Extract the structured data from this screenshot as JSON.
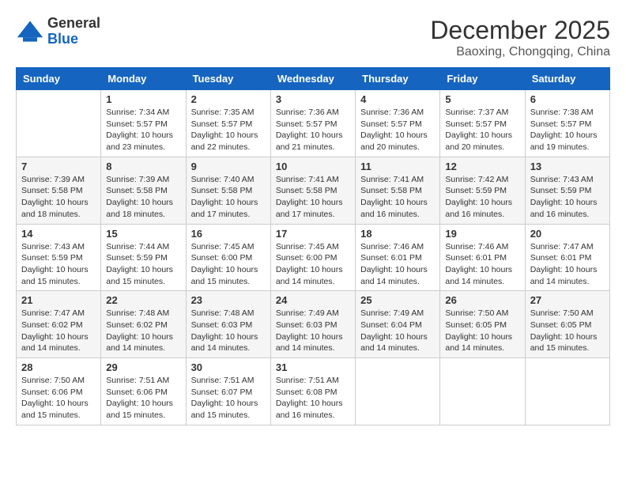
{
  "header": {
    "logo_general": "General",
    "logo_blue": "Blue",
    "month_year": "December 2025",
    "location": "Baoxing, Chongqing, China"
  },
  "weekdays": [
    "Sunday",
    "Monday",
    "Tuesday",
    "Wednesday",
    "Thursday",
    "Friday",
    "Saturday"
  ],
  "weeks": [
    [
      {
        "day": "",
        "sunrise": "",
        "sunset": "",
        "daylight": ""
      },
      {
        "day": "1",
        "sunrise": "Sunrise: 7:34 AM",
        "sunset": "Sunset: 5:57 PM",
        "daylight": "Daylight: 10 hours and 23 minutes."
      },
      {
        "day": "2",
        "sunrise": "Sunrise: 7:35 AM",
        "sunset": "Sunset: 5:57 PM",
        "daylight": "Daylight: 10 hours and 22 minutes."
      },
      {
        "day": "3",
        "sunrise": "Sunrise: 7:36 AM",
        "sunset": "Sunset: 5:57 PM",
        "daylight": "Daylight: 10 hours and 21 minutes."
      },
      {
        "day": "4",
        "sunrise": "Sunrise: 7:36 AM",
        "sunset": "Sunset: 5:57 PM",
        "daylight": "Daylight: 10 hours and 20 minutes."
      },
      {
        "day": "5",
        "sunrise": "Sunrise: 7:37 AM",
        "sunset": "Sunset: 5:57 PM",
        "daylight": "Daylight: 10 hours and 20 minutes."
      },
      {
        "day": "6",
        "sunrise": "Sunrise: 7:38 AM",
        "sunset": "Sunset: 5:57 PM",
        "daylight": "Daylight: 10 hours and 19 minutes."
      }
    ],
    [
      {
        "day": "7",
        "sunrise": "Sunrise: 7:39 AM",
        "sunset": "Sunset: 5:58 PM",
        "daylight": "Daylight: 10 hours and 18 minutes."
      },
      {
        "day": "8",
        "sunrise": "Sunrise: 7:39 AM",
        "sunset": "Sunset: 5:58 PM",
        "daylight": "Daylight: 10 hours and 18 minutes."
      },
      {
        "day": "9",
        "sunrise": "Sunrise: 7:40 AM",
        "sunset": "Sunset: 5:58 PM",
        "daylight": "Daylight: 10 hours and 17 minutes."
      },
      {
        "day": "10",
        "sunrise": "Sunrise: 7:41 AM",
        "sunset": "Sunset: 5:58 PM",
        "daylight": "Daylight: 10 hours and 17 minutes."
      },
      {
        "day": "11",
        "sunrise": "Sunrise: 7:41 AM",
        "sunset": "Sunset: 5:58 PM",
        "daylight": "Daylight: 10 hours and 16 minutes."
      },
      {
        "day": "12",
        "sunrise": "Sunrise: 7:42 AM",
        "sunset": "Sunset: 5:59 PM",
        "daylight": "Daylight: 10 hours and 16 minutes."
      },
      {
        "day": "13",
        "sunrise": "Sunrise: 7:43 AM",
        "sunset": "Sunset: 5:59 PM",
        "daylight": "Daylight: 10 hours and 16 minutes."
      }
    ],
    [
      {
        "day": "14",
        "sunrise": "Sunrise: 7:43 AM",
        "sunset": "Sunset: 5:59 PM",
        "daylight": "Daylight: 10 hours and 15 minutes."
      },
      {
        "day": "15",
        "sunrise": "Sunrise: 7:44 AM",
        "sunset": "Sunset: 5:59 PM",
        "daylight": "Daylight: 10 hours and 15 minutes."
      },
      {
        "day": "16",
        "sunrise": "Sunrise: 7:45 AM",
        "sunset": "Sunset: 6:00 PM",
        "daylight": "Daylight: 10 hours and 15 minutes."
      },
      {
        "day": "17",
        "sunrise": "Sunrise: 7:45 AM",
        "sunset": "Sunset: 6:00 PM",
        "daylight": "Daylight: 10 hours and 14 minutes."
      },
      {
        "day": "18",
        "sunrise": "Sunrise: 7:46 AM",
        "sunset": "Sunset: 6:01 PM",
        "daylight": "Daylight: 10 hours and 14 minutes."
      },
      {
        "day": "19",
        "sunrise": "Sunrise: 7:46 AM",
        "sunset": "Sunset: 6:01 PM",
        "daylight": "Daylight: 10 hours and 14 minutes."
      },
      {
        "day": "20",
        "sunrise": "Sunrise: 7:47 AM",
        "sunset": "Sunset: 6:01 PM",
        "daylight": "Daylight: 10 hours and 14 minutes."
      }
    ],
    [
      {
        "day": "21",
        "sunrise": "Sunrise: 7:47 AM",
        "sunset": "Sunset: 6:02 PM",
        "daylight": "Daylight: 10 hours and 14 minutes."
      },
      {
        "day": "22",
        "sunrise": "Sunrise: 7:48 AM",
        "sunset": "Sunset: 6:02 PM",
        "daylight": "Daylight: 10 hours and 14 minutes."
      },
      {
        "day": "23",
        "sunrise": "Sunrise: 7:48 AM",
        "sunset": "Sunset: 6:03 PM",
        "daylight": "Daylight: 10 hours and 14 minutes."
      },
      {
        "day": "24",
        "sunrise": "Sunrise: 7:49 AM",
        "sunset": "Sunset: 6:03 PM",
        "daylight": "Daylight: 10 hours and 14 minutes."
      },
      {
        "day": "25",
        "sunrise": "Sunrise: 7:49 AM",
        "sunset": "Sunset: 6:04 PM",
        "daylight": "Daylight: 10 hours and 14 minutes."
      },
      {
        "day": "26",
        "sunrise": "Sunrise: 7:50 AM",
        "sunset": "Sunset: 6:05 PM",
        "daylight": "Daylight: 10 hours and 14 minutes."
      },
      {
        "day": "27",
        "sunrise": "Sunrise: 7:50 AM",
        "sunset": "Sunset: 6:05 PM",
        "daylight": "Daylight: 10 hours and 15 minutes."
      }
    ],
    [
      {
        "day": "28",
        "sunrise": "Sunrise: 7:50 AM",
        "sunset": "Sunset: 6:06 PM",
        "daylight": "Daylight: 10 hours and 15 minutes."
      },
      {
        "day": "29",
        "sunrise": "Sunrise: 7:51 AM",
        "sunset": "Sunset: 6:06 PM",
        "daylight": "Daylight: 10 hours and 15 minutes."
      },
      {
        "day": "30",
        "sunrise": "Sunrise: 7:51 AM",
        "sunset": "Sunset: 6:07 PM",
        "daylight": "Daylight: 10 hours and 15 minutes."
      },
      {
        "day": "31",
        "sunrise": "Sunrise: 7:51 AM",
        "sunset": "Sunset: 6:08 PM",
        "daylight": "Daylight: 10 hours and 16 minutes."
      },
      {
        "day": "",
        "sunrise": "",
        "sunset": "",
        "daylight": ""
      },
      {
        "day": "",
        "sunrise": "",
        "sunset": "",
        "daylight": ""
      },
      {
        "day": "",
        "sunrise": "",
        "sunset": "",
        "daylight": ""
      }
    ]
  ]
}
